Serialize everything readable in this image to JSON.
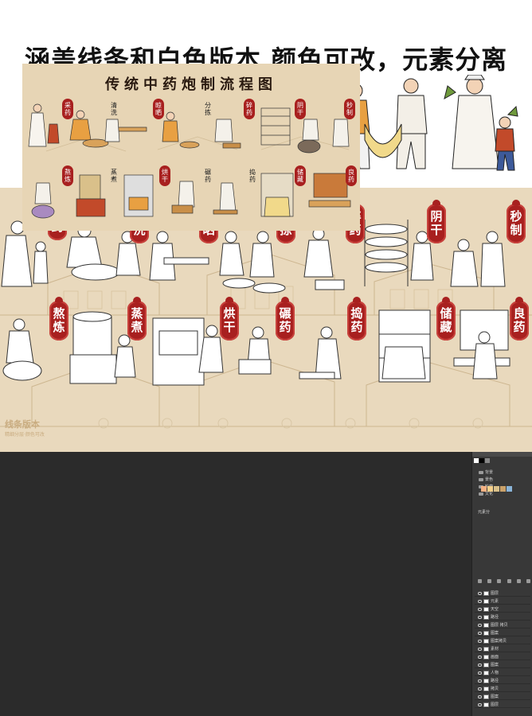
{
  "headline": "涵盖线条和白色版本 颜色可改，元素分离",
  "line_panel": {
    "version_label": "线条版本",
    "version_sub": "精细分层·颜色可改",
    "steps_row1": [
      "采药",
      "清洗",
      "晾晒",
      "分拣",
      "碎药",
      "阴干",
      "秒制"
    ],
    "steps_row2": [
      "熬炼",
      "蒸煮",
      "烘干",
      "碾药",
      "捣药",
      "储藏",
      "良药"
    ]
  },
  "poster": {
    "title": "传统中药炮制流程图",
    "steps_row1": [
      "采药",
      "清洗",
      "晾晒",
      "分拣",
      "碎药",
      "阴干",
      "秒制"
    ],
    "steps_row2": [
      "熬炼",
      "蒸煮",
      "烘干",
      "碾药",
      "捣药",
      "储藏",
      "良药"
    ]
  },
  "layers_panel": {
    "folders": [
      "背景",
      "景色",
      "轮廓",
      "文化"
    ],
    "section": "元素分",
    "layers": [
      "图层",
      "元素",
      "天空",
      "路径",
      "图层 拷贝",
      "图案",
      "图案拷贝",
      "素材",
      "画面",
      "图案",
      "人物",
      "路径",
      "拷贝",
      "图案",
      "图层"
    ]
  },
  "colors": {
    "tag_red": "#a8201f",
    "panel_beige": "#e9d9bd",
    "dark_bg": "#2b2b2b",
    "swatches": [
      "#f4b183",
      "#f6d08a",
      "#d9c08a",
      "#c9a16a",
      "#8ab4d8"
    ]
  }
}
